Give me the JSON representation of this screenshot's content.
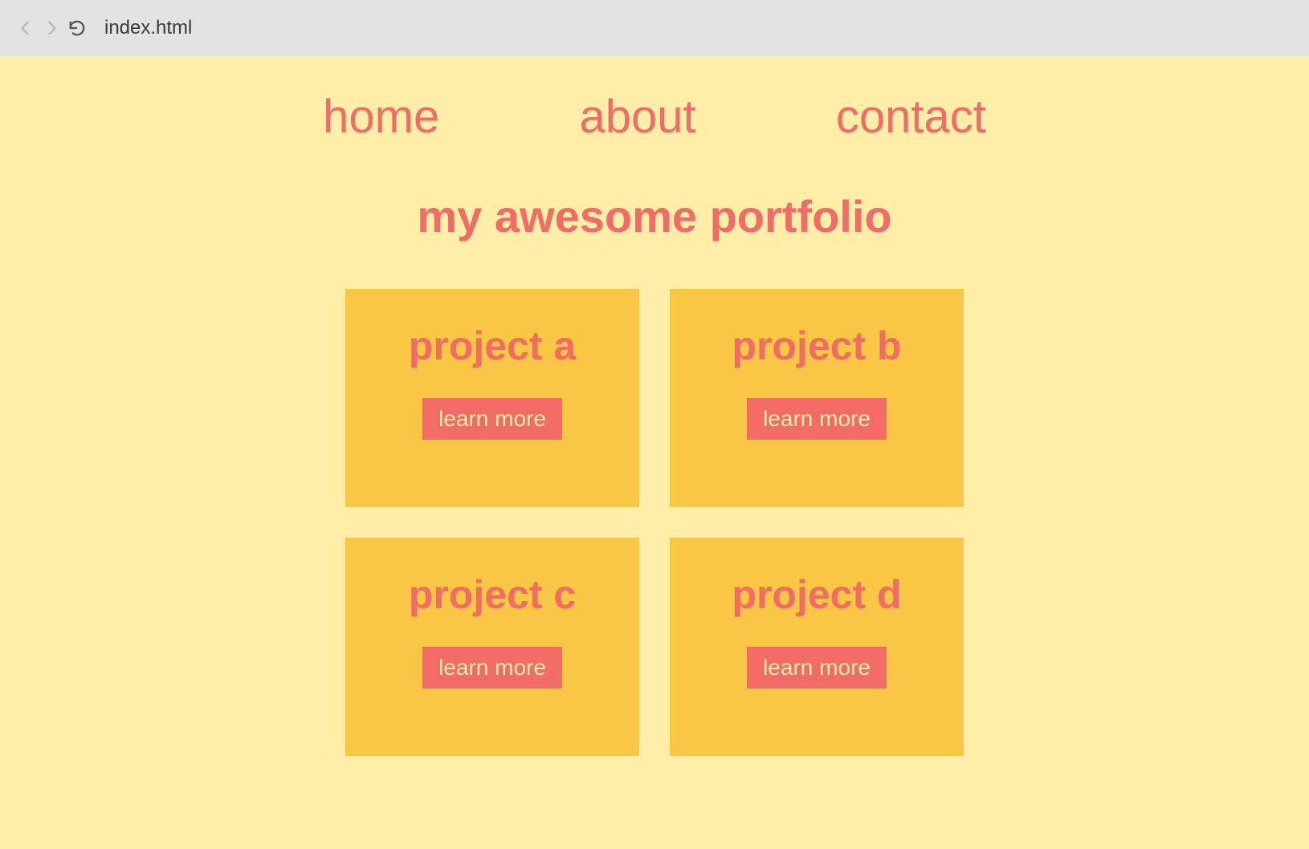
{
  "browser": {
    "url": "index.html"
  },
  "nav": {
    "items": [
      {
        "label": "home"
      },
      {
        "label": "about"
      },
      {
        "label": "contact"
      }
    ]
  },
  "page": {
    "title": "my awesome portfolio"
  },
  "projects": [
    {
      "title": "project a",
      "button": "learn more"
    },
    {
      "title": "project b",
      "button": "learn more"
    },
    {
      "title": "project c",
      "button": "learn more"
    },
    {
      "title": "project d",
      "button": "learn more"
    }
  ],
  "colors": {
    "page_bg": "#FFEDA8",
    "card_bg": "#F9C646",
    "accent": "#F26B66"
  }
}
